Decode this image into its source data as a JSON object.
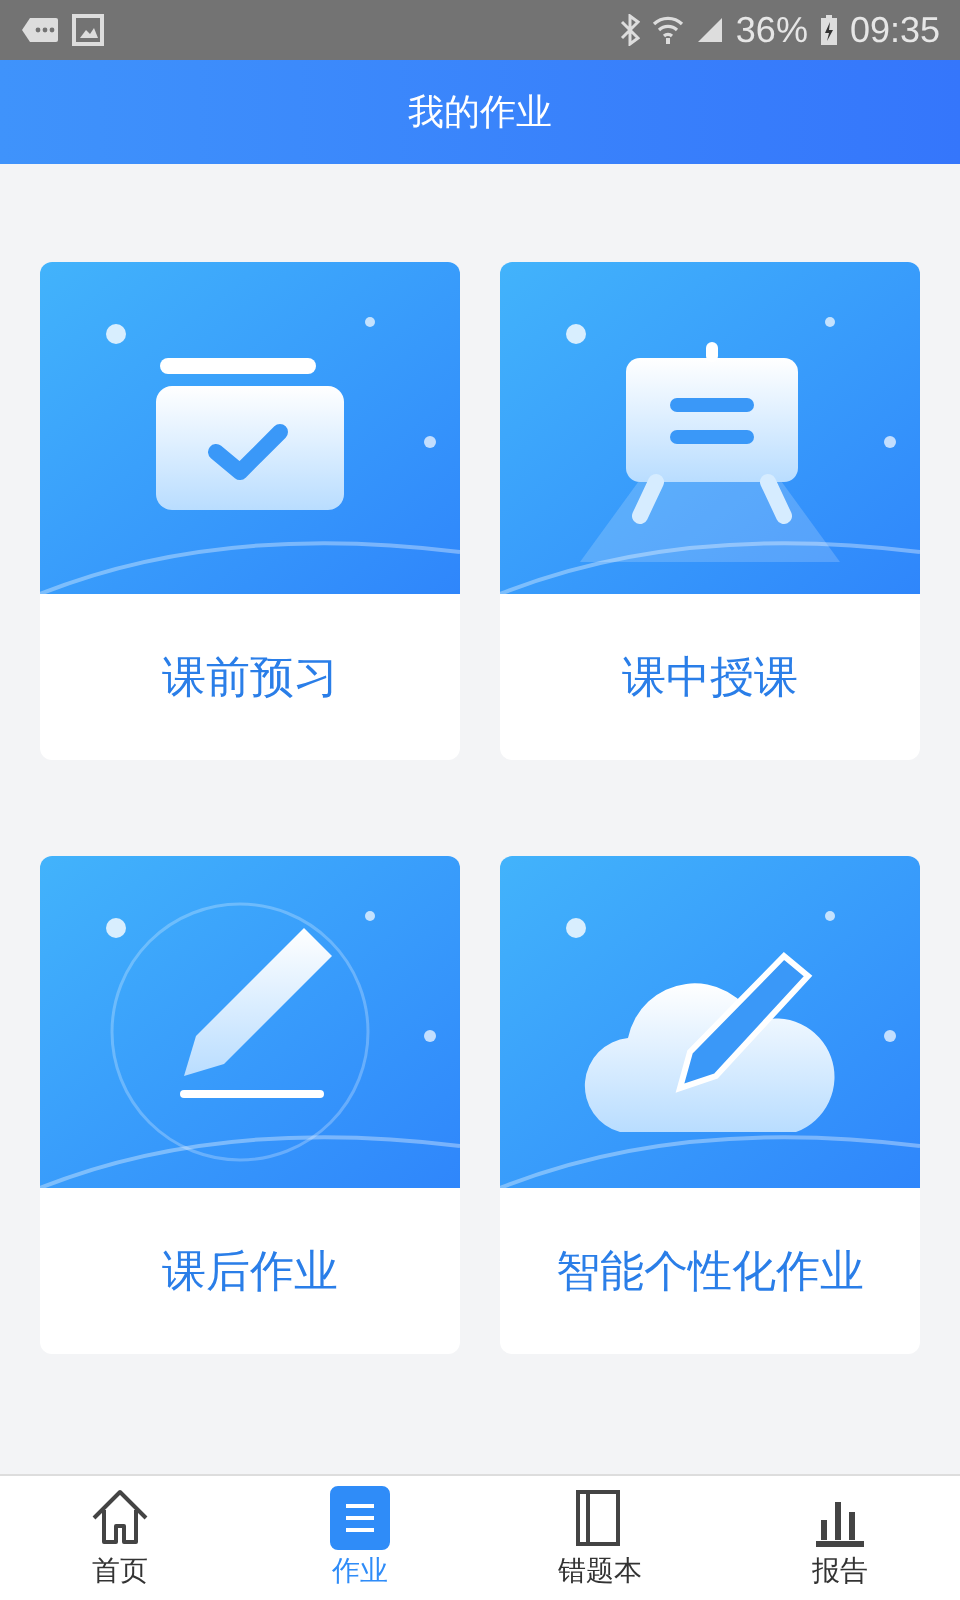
{
  "status_bar": {
    "battery": "36%",
    "time": "09:35"
  },
  "header": {
    "title": "我的作业"
  },
  "cards": [
    {
      "label": "课前预习",
      "kind": "checklist"
    },
    {
      "label": "课中授课",
      "kind": "easel"
    },
    {
      "label": "课后作业",
      "kind": "pencil"
    },
    {
      "label": "智能个性化作业",
      "kind": "cloud-pencil"
    }
  ],
  "nav": [
    {
      "label": "首页",
      "kind": "home",
      "selected": false
    },
    {
      "label": "作业",
      "kind": "homework",
      "selected": true
    },
    {
      "label": "错题本",
      "kind": "book",
      "selected": false
    },
    {
      "label": "报告",
      "kind": "report",
      "selected": false
    }
  ]
}
